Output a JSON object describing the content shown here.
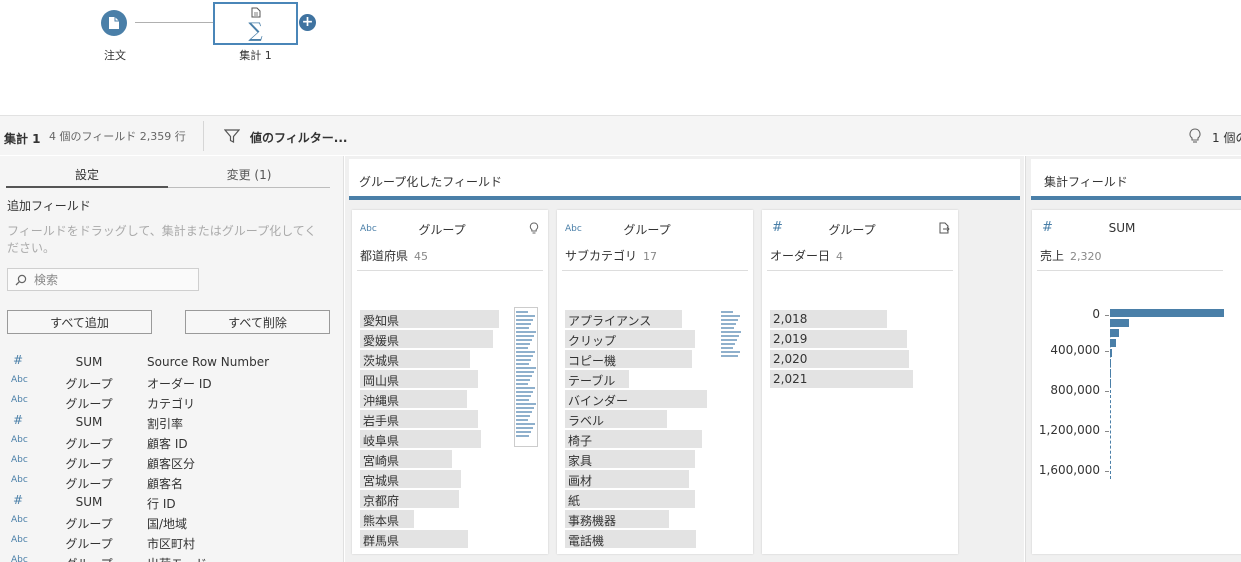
{
  "flow": {
    "input_label": "注文",
    "agg_label": "集計 1",
    "sigma": "∑",
    "add": "+"
  },
  "toolbar": {
    "name": "集計 1",
    "meta": "4 個のフィールド 2,359 行",
    "filter": "値のフィルター...",
    "recommend": "1 個の"
  },
  "left_panel": {
    "tabs": [
      {
        "label": "設定",
        "active": true
      },
      {
        "label": "変更 (1)",
        "active": false
      }
    ],
    "add_fields_title": "追加フィールド",
    "add_fields_desc": "フィールドをドラッグして、集計またはグループ化してください。",
    "search_placeholder": "検索",
    "add_all": "すべて追加",
    "remove_all": "すべて削除",
    "fields": [
      {
        "type": "#",
        "agg": "SUM",
        "name": "Source Row Number"
      },
      {
        "type": "Abc",
        "agg": "グループ",
        "name": "オーダー ID"
      },
      {
        "type": "Abc",
        "agg": "グループ",
        "name": "カテゴリ"
      },
      {
        "type": "#",
        "agg": "SUM",
        "name": "割引率"
      },
      {
        "type": "Abc",
        "agg": "グループ",
        "name": "顧客 ID"
      },
      {
        "type": "Abc",
        "agg": "グループ",
        "name": "顧客区分"
      },
      {
        "type": "Abc",
        "agg": "グループ",
        "name": "顧客名"
      },
      {
        "type": "#",
        "agg": "SUM",
        "name": "行 ID"
      },
      {
        "type": "Abc",
        "agg": "グループ",
        "name": "国/地域"
      },
      {
        "type": "Abc",
        "agg": "グループ",
        "name": "市区町村"
      },
      {
        "type": "Abc",
        "agg": "グループ",
        "name": "出荷モード"
      }
    ]
  },
  "group_region": {
    "title": "グループ化したフィールド",
    "cards": [
      {
        "type": "Abc",
        "agg": "グループ",
        "field": "都道府県",
        "count": "45",
        "items": [
          {
            "label": "愛知県",
            "w": 0.95
          },
          {
            "label": "愛媛県",
            "w": 0.91
          },
          {
            "label": "茨城県",
            "w": 0.75
          },
          {
            "label": "岡山県",
            "w": 0.81
          },
          {
            "label": "沖縄県",
            "w": 0.73
          },
          {
            "label": "岩手県",
            "w": 0.81
          },
          {
            "label": "岐阜県",
            "w": 0.83
          },
          {
            "label": "宮崎県",
            "w": 0.63
          },
          {
            "label": "宮城県",
            "w": 0.69
          },
          {
            "label": "京都府",
            "w": 0.68
          },
          {
            "label": "熊本県",
            "w": 0.37
          },
          {
            "label": "群馬県",
            "w": 0.74
          }
        ]
      },
      {
        "type": "Abc",
        "agg": "グループ",
        "field": "サブカテゴリ",
        "count": "17",
        "items": [
          {
            "label": "アプライアンス",
            "w": 0.8
          },
          {
            "label": "クリップ",
            "w": 0.89
          },
          {
            "label": "コピー機",
            "w": 0.87
          },
          {
            "label": "テーブル",
            "w": 0.44
          },
          {
            "label": "バインダー",
            "w": 0.97
          },
          {
            "label": "ラベル",
            "w": 0.7
          },
          {
            "label": "椅子",
            "w": 0.94
          },
          {
            "label": "家具",
            "w": 0.89
          },
          {
            "label": "画材",
            "w": 0.85
          },
          {
            "label": "紙",
            "w": 0.89
          },
          {
            "label": "事務機器",
            "w": 0.71
          },
          {
            "label": "電話機",
            "w": 0.9
          }
        ]
      },
      {
        "type": "#",
        "agg": "グループ",
        "field": "オーダー日",
        "count": "4",
        "items": [
          {
            "label": "2,018",
            "w": 0.8
          },
          {
            "label": "2,019",
            "w": 0.94
          },
          {
            "label": "2,020",
            "w": 0.95
          },
          {
            "label": "2,021",
            "w": 0.98
          }
        ]
      }
    ]
  },
  "agg_region": {
    "title": "集計フィールド",
    "card": {
      "type": "#",
      "agg": "SUM",
      "field": "売上",
      "count": "2,320",
      "labels": [
        "0",
        "400,000",
        "800,000",
        "1,200,000",
        "1,600,000"
      ],
      "bins": [
        1.0,
        0.17,
        0.08,
        0.05,
        0.02,
        0.01,
        0.01,
        0.01
      ]
    }
  },
  "colors": {
    "accent": "#4a7fa8",
    "bar": "#e3e3e3",
    "panel": "#f5f5f5"
  }
}
